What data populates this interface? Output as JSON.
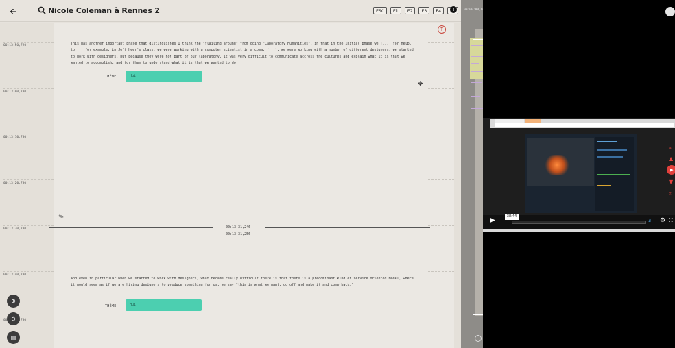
{
  "header": {
    "back_icon": "arrow-left-icon",
    "search_icon": "search-icon",
    "title": "Nicole Coleman à Rennes 2",
    "keys": [
      "ESC",
      "F1",
      "F2",
      "F3",
      "F4",
      "F5"
    ],
    "info_icon": "info-icon"
  },
  "transcript": {
    "timestamps": [
      "00:13:50,720",
      "00:13:00,780",
      "00:13:10,780",
      "00:13:20,780",
      "00:13:30,780",
      "00:13:40,780",
      "00:13:50,780"
    ],
    "segments": [
      {
        "text": "This was another important phase that distinguishes I think the \"flailing around\" from doing \"Laboratory Humanities\", in that in the initial phase we [...] for help, to ... for example, in Jeff Heer's class, we were working with a computer scientist in a coma, [...], we were working with a number of different designers, we started to work with designers, but because they were not part of our laboratory, it was very difficult to communicate accross the cultures and explain what it is that we wanted to accomplish, and for them to understand what it is that we wanted to do.",
        "theme_label": "THÈME",
        "theme_value": "Hui"
      },
      {
        "text": "And even in particular when we started to work with designers, what became really difficult there is that there is a predominant kind of service oriented model, where it would seem as if we are hiring designers to produce something for us, we say \"this is what we want, go off and make it and come back.\"",
        "theme_label": "THÈME",
        "theme_value": "Hui"
      }
    ],
    "cut_start": "00:13:31,246",
    "cut_end": "00:13:31,256"
  },
  "timeline": {
    "current_time": "00:00:00,000"
  },
  "video": {
    "time_tooltip": "38:44",
    "colors": {
      "accent": "#e2403c",
      "volume": "#4aa3e0"
    }
  },
  "colors": {
    "theme_chip": "#4ccfb0",
    "background": "#e6e2dc"
  }
}
